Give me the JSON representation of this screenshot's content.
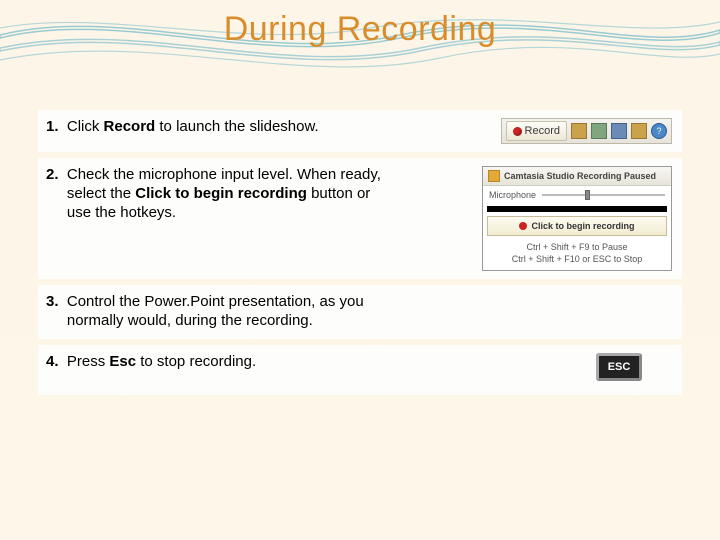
{
  "title": "During Recording",
  "steps": [
    {
      "num": "1.",
      "html": "Click <b>Record</b> to launch the slideshow."
    },
    {
      "num": "2.",
      "html": "Check the microphone input level. When ready, select the <b>Click to begin recording</b> button or use the hotkeys."
    },
    {
      "num": "3.",
      "html": "Control the Power.Point presentation, as you normally would, during the recording."
    },
    {
      "num": "4.",
      "html": "Press <b>Esc</b> to stop recording."
    }
  ],
  "toolbar": {
    "record_label": "Record"
  },
  "camtasia": {
    "header": "Camtasia Studio Recording Paused",
    "mic_label": "Microphone",
    "start_label": "Click to begin recording",
    "hotkey1": "Ctrl + Shift + F9 to Pause",
    "hotkey2": "Ctrl + Shift + F10 or ESC to Stop"
  },
  "esc_label": "ESC"
}
